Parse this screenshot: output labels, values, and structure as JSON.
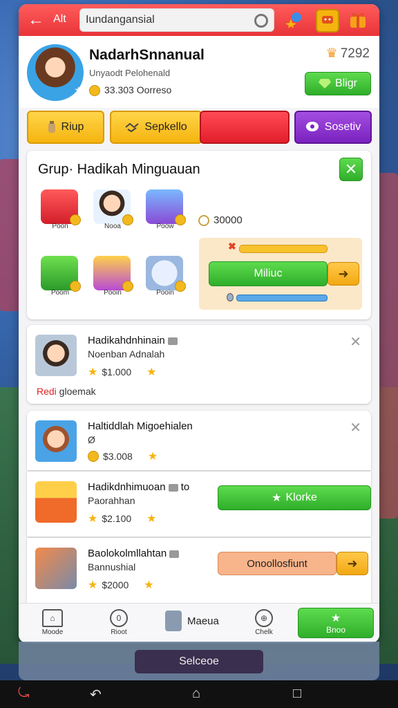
{
  "header": {
    "back_label": "Alt",
    "search_value": "Iundangansial"
  },
  "profile": {
    "name": "NadarhSnnanual",
    "subtitle": "Unyaodt Pelohenald",
    "coins": "33.303 Oorreso",
    "level": "7292",
    "action_label": "Bligr"
  },
  "tabs": [
    {
      "label": "Riup"
    },
    {
      "label": "Sepkello"
    },
    {
      "label": ""
    },
    {
      "label": "Sosetiv"
    }
  ],
  "gift": {
    "title": "Grup· Hadikah Minguauan",
    "items": [
      {
        "caption": "Poon"
      },
      {
        "caption": "Nooa"
      },
      {
        "caption": "Poow"
      },
      {
        "caption": "Poom"
      },
      {
        "caption": "Pooin"
      },
      {
        "caption": "Pooin"
      }
    ],
    "amount": "30000",
    "action_label": "Miliuc"
  },
  "cards": [
    {
      "title": "Hadikahdnhinain",
      "subtitle": "Noenban Adnalah",
      "price": "$1.000",
      "note_red": "Redi",
      "note_rest": " gloemak"
    },
    {
      "title": "Haltiddlah Migoehialen",
      "subtitle": "Ø",
      "price": "$3.008"
    },
    {
      "title": "Hadikdnhimuoan",
      "extra": "to",
      "subtitle": "Paorahhan",
      "price": "$2.100",
      "action_label": "Klorke"
    },
    {
      "title": "Baolokolmllahtan",
      "subtitle": "Bannushial",
      "price": "$2000",
      "action_label": "Onoollosfiunt"
    }
  ],
  "navbar": {
    "items": [
      {
        "label": "Moode"
      },
      {
        "label": "Rioot",
        "icon_text": "0"
      },
      {
        "label": "Maeua"
      },
      {
        "label": "Chelk"
      },
      {
        "label": "Bnoo"
      }
    ]
  },
  "under_button": "Selceoe",
  "colors": {
    "accent_red": "#e83438",
    "green": "#2fae2a",
    "yellow": "#f5b40f",
    "purple": "#7a22c0"
  }
}
